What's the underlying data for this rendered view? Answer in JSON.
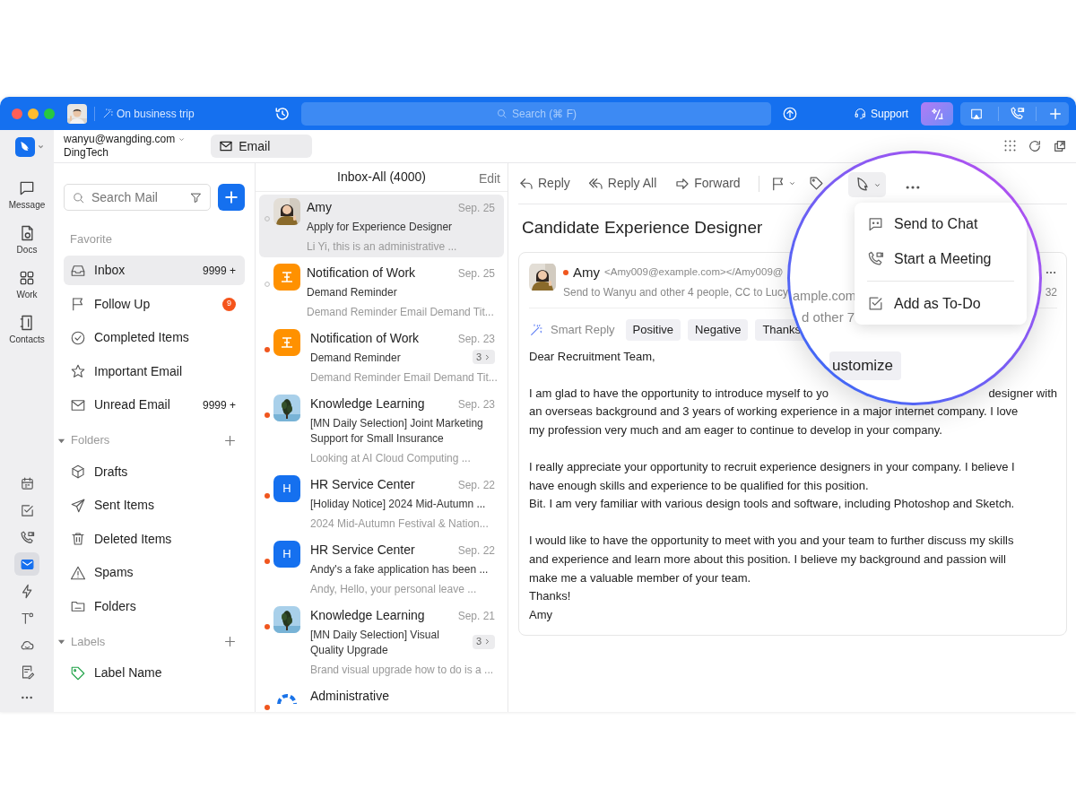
{
  "titlebar": {
    "status": "On business trip",
    "search_placeholder": "Search (⌘ F)",
    "support": "Support"
  },
  "rail": {
    "apps": [
      {
        "label": "Message"
      },
      {
        "label": "Docs"
      },
      {
        "label": "Work"
      },
      {
        "label": "Contacts"
      }
    ],
    "tools": [
      {
        "selected": false
      },
      {
        "selected": false
      },
      {
        "selected": false
      },
      {
        "selected": true
      },
      {
        "selected": false
      },
      {
        "selected": false
      },
      {
        "selected": false
      },
      {
        "selected": false
      }
    ]
  },
  "account": {
    "email": "wanyu@wangding.com",
    "org": "DingTech",
    "tab": "Email"
  },
  "mailbox": {
    "search_placeholder": "Search Mail",
    "sections": [
      {
        "title": "Favorite",
        "kind": "plain",
        "items": [
          {
            "label": "Inbox",
            "count": "9999 +",
            "selected": true
          },
          {
            "label": "Follow Up",
            "badge": "9",
            "selected": false
          },
          {
            "label": "Completed Items",
            "selected": false
          },
          {
            "label": "Important Email",
            "selected": false
          },
          {
            "label": "Unread Email",
            "count": "9999 +",
            "selected": false
          }
        ]
      },
      {
        "title": "Folders",
        "kind": "group",
        "expanded": true,
        "items": [
          {
            "label": "Drafts",
            "selected": false
          },
          {
            "label": "Sent Items",
            "selected": false
          },
          {
            "label": "Deleted Items",
            "selected": false
          },
          {
            "label": "Spams",
            "selected": false
          },
          {
            "label": "Folders",
            "selected": false
          }
        ]
      },
      {
        "title": "Labels",
        "kind": "group",
        "expanded": true,
        "items": [
          {
            "label": "Label Name",
            "selected": false
          }
        ]
      }
    ]
  },
  "messages": {
    "title": "Inbox-All (4000)",
    "edit": "Edit",
    "items": [
      {
        "sender": "Amy",
        "date": "Sep. 25",
        "subject": "Apply for Experience Designer",
        "preview": "Li Yi, this is an administrative ...",
        "unread": false,
        "selected": true
      },
      {
        "sender": "Notification of Work",
        "date": "Sep. 25",
        "subject": "Demand Reminder",
        "preview": "Demand Reminder Email Demand Tit...",
        "unread": false,
        "selected": false,
        "avatar": {
          "kind": "work"
        }
      },
      {
        "sender": "Notification of Work",
        "date": "Sep. 23",
        "subject": "Demand Reminder",
        "thread": "3",
        "preview": "Demand Reminder Email Demand Tit...",
        "unread": true,
        "selected": false,
        "avatar": {
          "kind": "work"
        }
      },
      {
        "sender": "Knowledge Learning",
        "date": "Sep. 23",
        "subject": "[MN Daily Selection] Joint Marketing Support for Small Insurance",
        "preview": "Looking at AI Cloud Computing ...",
        "unread": true,
        "selected": false,
        "avatar": {
          "kind": "plant"
        }
      },
      {
        "sender": "HR Service Center",
        "date": "Sep. 22",
        "subject": "[Holiday Notice] 2024 Mid-Autumn ...",
        "preview": "2024 Mid-Autumn Festival & Nation...",
        "unread": true,
        "selected": false,
        "avatar": {
          "kind": "letter",
          "letter": "H"
        }
      },
      {
        "sender": "HR Service Center",
        "date": "Sep. 22",
        "subject": "Andy's a fake application has been ...",
        "preview": "Andy, Hello, your personal leave ...",
        "unread": true,
        "selected": false,
        "avatar": {
          "kind": "letter",
          "letter": "H"
        }
      },
      {
        "sender": "Knowledge Learning",
        "date": "Sep. 21",
        "subject": "[MN Daily Selection] Visual Quality Upgrade",
        "thread": "3",
        "preview": "Brand visual upgrade how to do is a ...",
        "unread": true,
        "selected": false,
        "avatar": {
          "kind": "plant"
        }
      },
      {
        "sender": "Administrative",
        "unread": true,
        "selected": false,
        "avatar": {
          "kind": "logo"
        }
      }
    ]
  },
  "reading": {
    "toolbar": [
      {
        "label": "Reply"
      },
      {
        "label": "Reply All"
      },
      {
        "label": "Forward"
      }
    ],
    "title": "Candidate Experience Designer",
    "sender": {
      "name": "Amy",
      "email": "<Amy009@example.com></Amy009@",
      "recipients": "Send to Wanyu and other 4 people, CC to Lucy",
      "time": "32",
      "unread": true
    },
    "smart_reply": {
      "label": "Smart Reply",
      "chips": [
        "Positive",
        "Negative",
        "Thanks"
      ]
    },
    "greeting": "Dear Recruitment Team,",
    "intro": {
      "left": "I am glad to have the opportunity to introduce myself to yo",
      "right": "designer with",
      "rest": "an overseas background and 3 years of working experience in a major internet company. I love\nmy profession very much and am eager to continue to develop in your company."
    },
    "paragraphs": [
      "I really appreciate your opportunity to recruit experience designers in your company. I believe I\nhave enough skills and experience to be qualified for this position.\nBit. I am very familiar with various design tools and software, including Photoshop and Sketch.",
      "I would like to have the opportunity to meet with you and your team to further discuss my skills\nand experience and learn more about this position. I believe my background and passion will\nmake me a valuable member of your team.\nThanks!\nAmy"
    ]
  },
  "magnifier": {
    "menu": [
      {
        "label": "Send to Chat",
        "divider_before": false
      },
      {
        "label": "Start a Meeting",
        "divider_before": false
      },
      {
        "label": "Add as To-Do",
        "divider_before": true
      }
    ],
    "email_fragment": "ample.com",
    "recipients_fragment": "d other 7",
    "chip_fragment": "ustomize"
  }
}
